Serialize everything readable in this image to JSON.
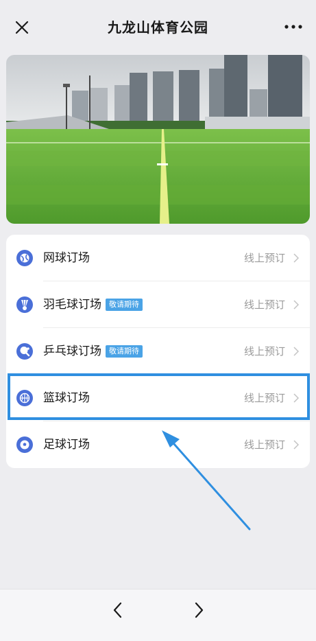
{
  "header": {
    "title": "九龙山体育公园",
    "close_icon": "close-icon",
    "more_icon": "more-dots-icon"
  },
  "venues": [
    {
      "name": "网球订场",
      "tag": "",
      "action": "线上预订",
      "icon": "tennis-icon"
    },
    {
      "name": "羽毛球订场",
      "tag": "敬请期待",
      "action": "线上预订",
      "icon": "badminton-icon"
    },
    {
      "name": "乒乓球订场",
      "tag": "敬请期待",
      "action": "线上预订",
      "icon": "table-tennis-icon"
    },
    {
      "name": "篮球订场",
      "tag": "",
      "action": "线上预订",
      "icon": "basketball-icon"
    },
    {
      "name": "足球订场",
      "tag": "",
      "action": "线上预订",
      "icon": "football-icon"
    }
  ],
  "bottom_nav": {
    "back_icon": "chevron-left-icon",
    "forward_icon": "chevron-right-icon"
  },
  "colors": {
    "accent": "#4a6fd8",
    "tag_bg": "#4aa3e6",
    "highlight": "#2f8fe0",
    "muted_text": "#9b9b9b"
  }
}
